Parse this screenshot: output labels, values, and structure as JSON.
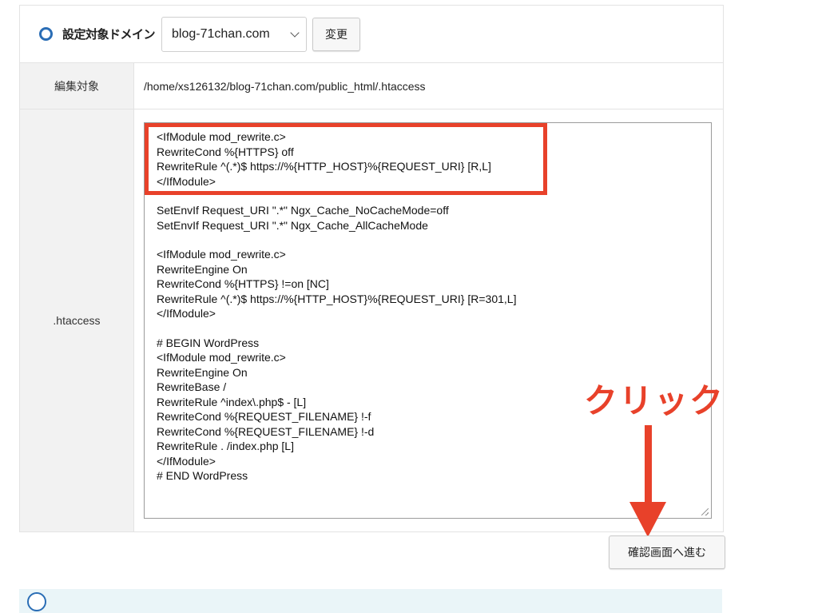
{
  "domain_row": {
    "label": "設定対象ドメイン",
    "selected_domain": "blog-71chan.com",
    "change_button": "変更"
  },
  "target_row": {
    "label": "編集対象",
    "path": "/home/xs126132/blog-71chan.com/public_html/.htaccess"
  },
  "htaccess_row": {
    "label": ".htaccess",
    "lines": [
      "<IfModule mod_rewrite.c>",
      "RewriteCond %{HTTPS} off",
      "RewriteRule ^(.*)$ https://%{HTTP_HOST}%{REQUEST_URI} [R,L]",
      "</IfModule>",
      "",
      "SetEnvIf Request_URI \".*\" Ngx_Cache_NoCacheMode=off",
      "SetEnvIf Request_URI \".*\" Ngx_Cache_AllCacheMode",
      "",
      "<IfModule mod_rewrite.c>",
      "RewriteEngine On",
      "RewriteCond %{HTTPS} !=on [NC]",
      "RewriteRule ^(.*)$ https://%{HTTP_HOST}%{REQUEST_URI} [R=301,L]",
      "</IfModule>",
      "",
      "# BEGIN WordPress",
      "<IfModule mod_rewrite.c>",
      "RewriteEngine On",
      "RewriteBase /",
      "RewriteRule ^index\\.php$ - [L]",
      "RewriteCond %{REQUEST_FILENAME} !-f",
      "RewriteCond %{REQUEST_FILENAME} !-d",
      "RewriteRule . /index.php [L]",
      "</IfModule>",
      "# END WordPress"
    ]
  },
  "annotation": {
    "click_text": "クリック",
    "highlight_color": "#e8412a"
  },
  "confirm_button": "確認画面へ進む",
  "icons": {
    "radio": "radio-selected-icon",
    "select": "chevron-down-icon",
    "info": "info-icon"
  }
}
